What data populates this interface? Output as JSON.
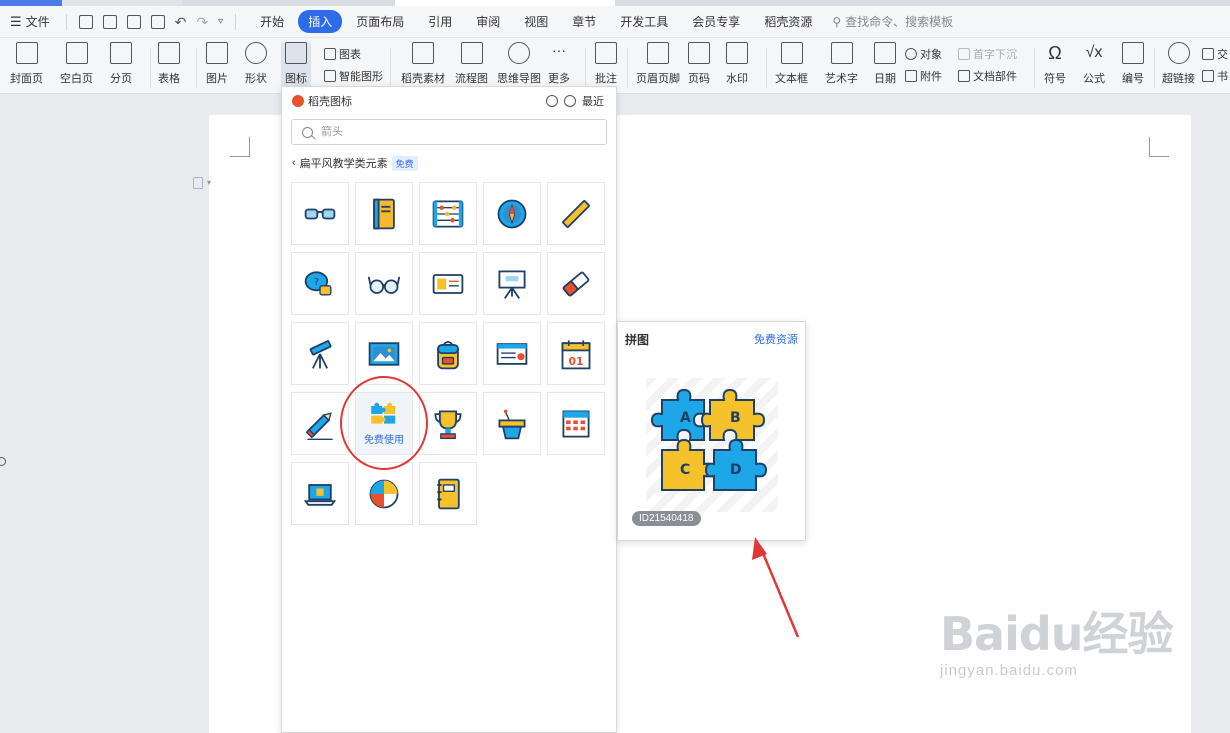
{
  "menubar": {
    "file_label": "文件",
    "tabs": [
      "开始",
      "插入",
      "页面布局",
      "引用",
      "审阅",
      "视图",
      "章节",
      "开发工具",
      "会员专享",
      "稻壳资源"
    ],
    "active_tab": "插入",
    "search_placeholder": "查找命令、搜索模板"
  },
  "ribbon": {
    "cover": "封面页",
    "blank": "空白页",
    "pagebreak": "分页",
    "table": "表格",
    "picture": "图片",
    "shape": "形状",
    "icon": "图标",
    "chart": "图表",
    "smartart": "智能图形",
    "docer_material": "稻壳素材",
    "flowchart": "流程图",
    "mindmap": "思维导图",
    "more": "更多",
    "comment": "批注",
    "header_footer": "页眉页脚",
    "page_number": "页码",
    "watermark": "水印",
    "textbox": "文本框",
    "wordart": "艺术字",
    "date": "日期",
    "object": "对象",
    "attachment": "附件",
    "dropcap": "首字下沉",
    "doc_parts": "文档部件",
    "symbol": "符号",
    "formula": "公式",
    "numbering": "编号",
    "hyperlink": "超链接",
    "cross_ref": "交",
    "bookmark": "书"
  },
  "panel": {
    "title": "稻壳图标",
    "recent": "最近",
    "search_placeholder": "箭头",
    "breadcrumb": "扁平风教学类元素",
    "free_badge": "免费",
    "icons": [
      "glasses-icon",
      "book-icon",
      "abacus-icon",
      "compass-icon",
      "ruler-icon",
      "chat-lock-icon",
      "round-glasses-icon",
      "id-card-icon",
      "easel-icon",
      "eraser-icon",
      "telescope-icon",
      "picture-frame-icon",
      "backpack-icon",
      "certificate-icon",
      "calendar-icon",
      "pencil-icon",
      "puzzle-icon",
      "trophy-icon",
      "podium-icon",
      "calculator-icon",
      "laptop-icon",
      "globe-icon",
      "notebook-icon"
    ],
    "calendar_day": "01",
    "hover_label": "免费使用"
  },
  "preview": {
    "title": "拼图",
    "link": "免费资源",
    "id": "ID21540418",
    "pieces": [
      "A",
      "B",
      "C",
      "D"
    ]
  },
  "watermark": {
    "main": "Baidu经验",
    "sub": "jingyan.baidu.com"
  },
  "colors": {
    "accent": "#2f6be8",
    "puzzle_blue": "#1ea7e8",
    "puzzle_yellow": "#f5c22b",
    "annotation_red": "#e03838"
  }
}
